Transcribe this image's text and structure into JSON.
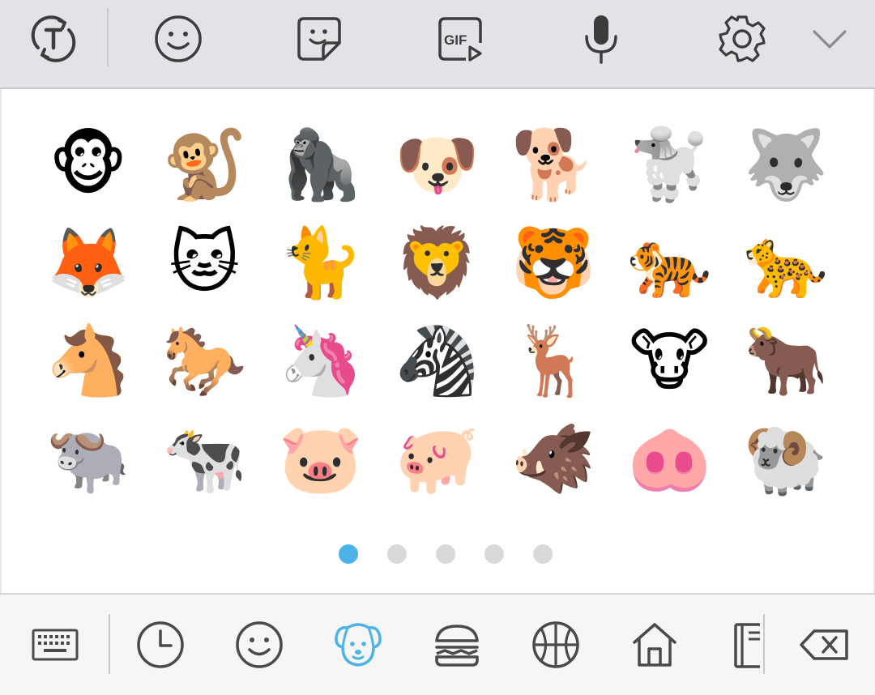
{
  "colors": {
    "icon_gray": "#3c3c3c",
    "active_blue": "#4db3e6",
    "dot_inactive": "#d9d9db",
    "toolbar_bg": "#e2e3e6"
  },
  "toolbar": {
    "items": [
      {
        "name": "text-translate-icon"
      },
      {
        "name": "emoji-icon"
      },
      {
        "name": "sticker-icon"
      },
      {
        "name": "gif-icon",
        "label": "GIF"
      },
      {
        "name": "microphone-icon"
      },
      {
        "name": "settings-gear-icon"
      },
      {
        "name": "chevron-down-icon"
      }
    ]
  },
  "emoji_grid": [
    [
      "🐵",
      "🐒",
      "🦍",
      "🐶",
      "🐕",
      "🐩",
      "🐺"
    ],
    [
      "🦊",
      "🐱",
      "🐈",
      "🦁",
      "🐯",
      "🐅",
      "🐆"
    ],
    [
      "🐴",
      "🐎",
      "🦄",
      "🦓",
      "🦌",
      "🐮",
      "🐂"
    ],
    [
      "🐃",
      "🐄",
      "🐷",
      "🐖",
      "🐗",
      "🐽",
      "🐏"
    ]
  ],
  "pager": {
    "pages": 5,
    "current": 1
  },
  "categories": [
    {
      "name": "keyboard-icon",
      "active": false
    },
    {
      "name": "recent-clock-icon",
      "active": false
    },
    {
      "name": "smileys-icon",
      "active": false
    },
    {
      "name": "animals-dog-icon",
      "active": true
    },
    {
      "name": "food-burger-icon",
      "active": false
    },
    {
      "name": "sports-basketball-icon",
      "active": false
    },
    {
      "name": "places-house-icon",
      "active": false
    },
    {
      "name": "objects-notebook-icon",
      "active": false
    },
    {
      "name": "backspace-icon",
      "active": false
    }
  ]
}
